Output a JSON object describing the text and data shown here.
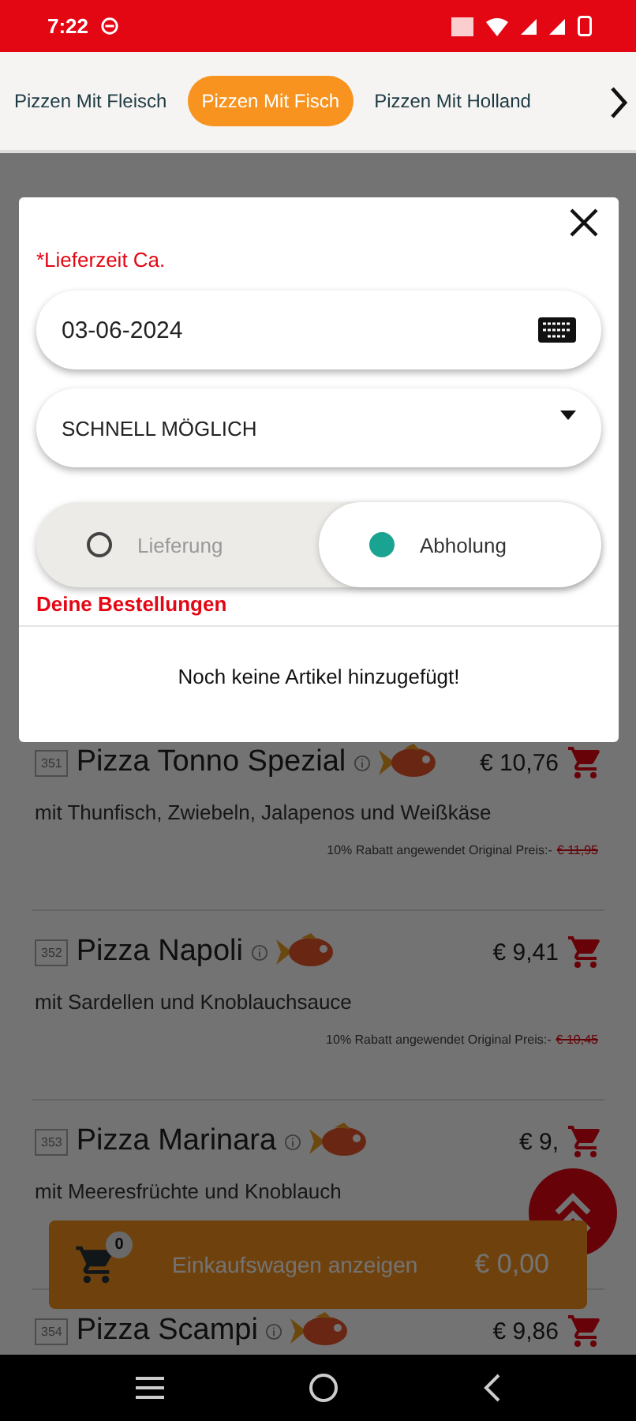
{
  "status_bar": {
    "time": "7:22"
  },
  "tabs": [
    {
      "label": "Pizzen Mit Fleisch",
      "selected": false
    },
    {
      "label": "Pizzen Mit Fisch",
      "selected": true
    },
    {
      "label": "Pizzen Mit Holland",
      "selected": false
    }
  ],
  "products": [
    {
      "number": "351",
      "name": "Pizza Tonno Spezial",
      "price": "€ 10,76",
      "description": "mit Thunfisch, Zwiebeln, Jalapenos und Weißkäse",
      "discount_note": "10% Rabatt angewendet Original Preis:-",
      "original_price": "€ 11,95"
    },
    {
      "number": "352",
      "name": "Pizza Napoli",
      "price": "€ 9,41",
      "description": "mit Sardellen und Knoblauchsauce",
      "discount_note": "10% Rabatt angewendet Original Preis:-",
      "original_price": "€ 10,45"
    },
    {
      "number": "353",
      "name": "Pizza Marinara",
      "price": "€ 9,",
      "description": "mit Meeresfrüchte und Knoblauch"
    },
    {
      "number": "354",
      "name": "Pizza Scampi",
      "price": "€ 9,86"
    }
  ],
  "cart_bar": {
    "count": "0",
    "label": "Einkaufswagen anzeigen",
    "total": "€ 0,00"
  },
  "modal": {
    "label": "*Lieferzeit Ca.",
    "date": "03-06-2024",
    "time_select": "SCHNELL MÖGLICH",
    "options": [
      {
        "label": "Lieferung",
        "selected": false
      },
      {
        "label": "Abholung",
        "selected": true
      }
    ],
    "orders_title": "Deine Bestellungen",
    "empty_text": "Noch keine Artikel hinzugefügt!"
  }
}
